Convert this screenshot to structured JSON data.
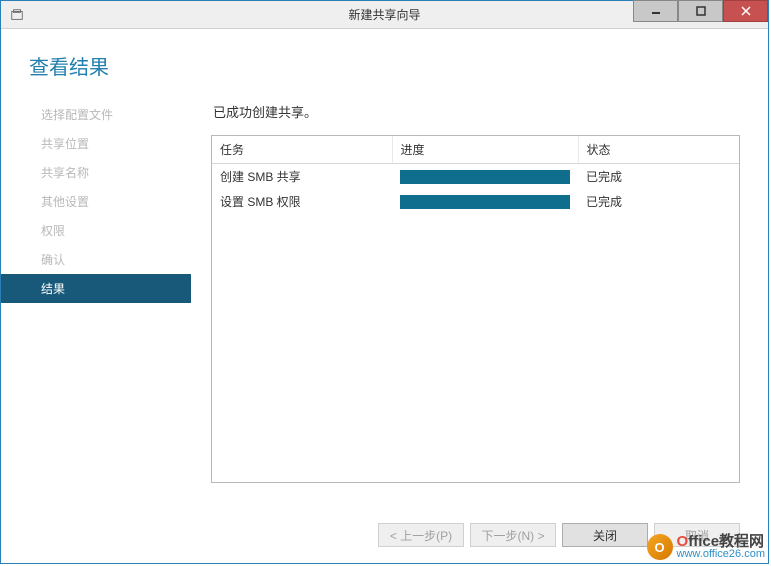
{
  "titlebar": {
    "title": "新建共享向导"
  },
  "heading": "查看结果",
  "sidebar": {
    "items": [
      {
        "label": "选择配置文件"
      },
      {
        "label": "共享位置"
      },
      {
        "label": "共享名称"
      },
      {
        "label": "其他设置"
      },
      {
        "label": "权限"
      },
      {
        "label": "确认"
      },
      {
        "label": "结果"
      }
    ]
  },
  "main": {
    "status_text": "已成功创建共享。",
    "table": {
      "headers": {
        "task": "任务",
        "progress": "进度",
        "status": "状态"
      },
      "rows": [
        {
          "task": "创建 SMB 共享",
          "progress_pct": 100,
          "status": "已完成"
        },
        {
          "task": "设置 SMB 权限",
          "progress_pct": 100,
          "status": "已完成"
        }
      ]
    }
  },
  "footer": {
    "prev": "< 上一步(P)",
    "next": "下一步(N) >",
    "close": "关闭",
    "cancel": "取消"
  },
  "watermark": {
    "brand_prefix": "O",
    "brand_rest": "ffice教程网",
    "url": "www.office26.com"
  }
}
